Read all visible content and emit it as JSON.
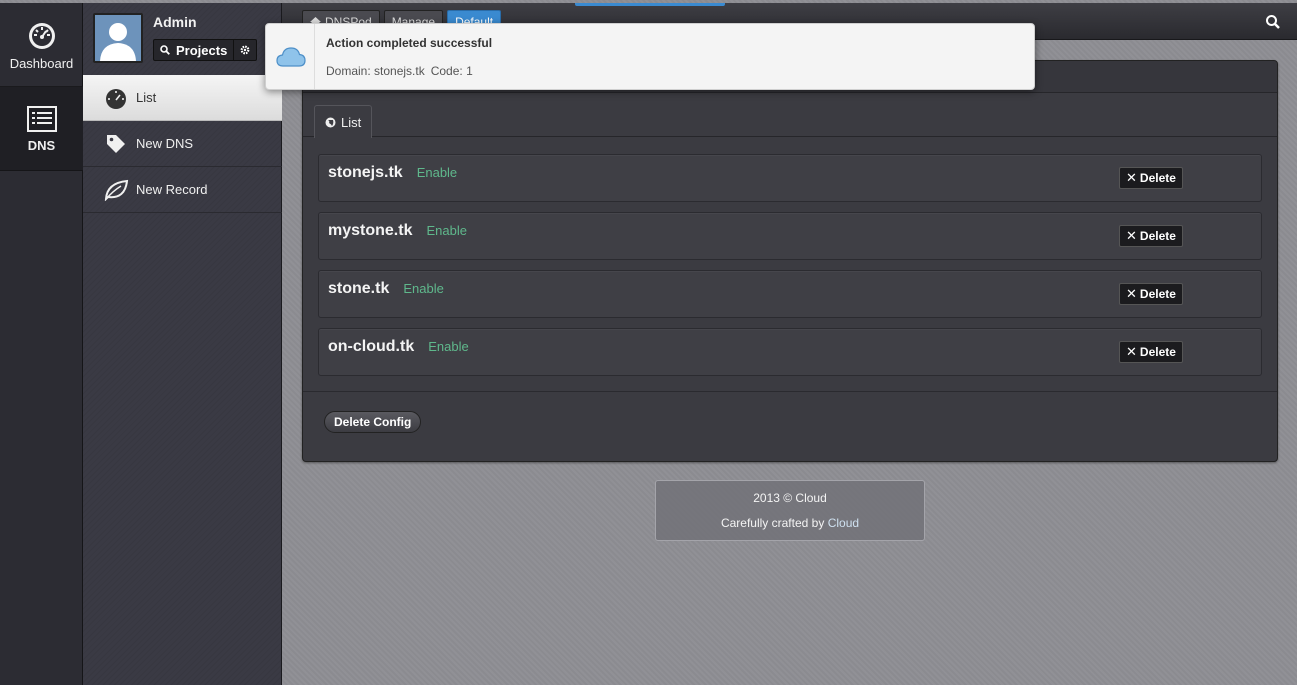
{
  "rail": {
    "items": [
      {
        "label": "Dashboard",
        "icon": "dashboard-icon"
      },
      {
        "label": "DNS",
        "icon": "list-icon"
      }
    ]
  },
  "profile": {
    "name": "Admin",
    "projects_label": "Projects"
  },
  "subnav": {
    "items": [
      {
        "label": "List",
        "icon": "dashboard-icon",
        "active": true
      },
      {
        "label": "New DNS",
        "icon": "tag-icon"
      },
      {
        "label": "New Record",
        "icon": "leaf-icon"
      }
    ]
  },
  "breadcrumb": {
    "items": [
      "DNSPod",
      "Manage",
      "Default"
    ]
  },
  "panel": {
    "tab_label": "List",
    "domains": [
      {
        "name": "stonejs.tk",
        "status": "Enable",
        "delete_label": "Delete"
      },
      {
        "name": "mystone.tk",
        "status": "Enable",
        "delete_label": "Delete"
      },
      {
        "name": "stone.tk",
        "status": "Enable",
        "delete_label": "Delete"
      },
      {
        "name": "on-cloud.tk",
        "status": "Enable",
        "delete_label": "Delete"
      }
    ],
    "delete_config_label": "Delete Config"
  },
  "footer": {
    "copyright": "2013 © Cloud",
    "crafted_prefix": "Carefully crafted by",
    "crafted_link": "Cloud"
  },
  "toast": {
    "title": "Action completed successful",
    "domain_text": "Domain: stonejs.tk",
    "code_text": "Code: 1"
  },
  "colors": {
    "accent": "#3a8ad0",
    "status_enable": "#5fb88c"
  }
}
